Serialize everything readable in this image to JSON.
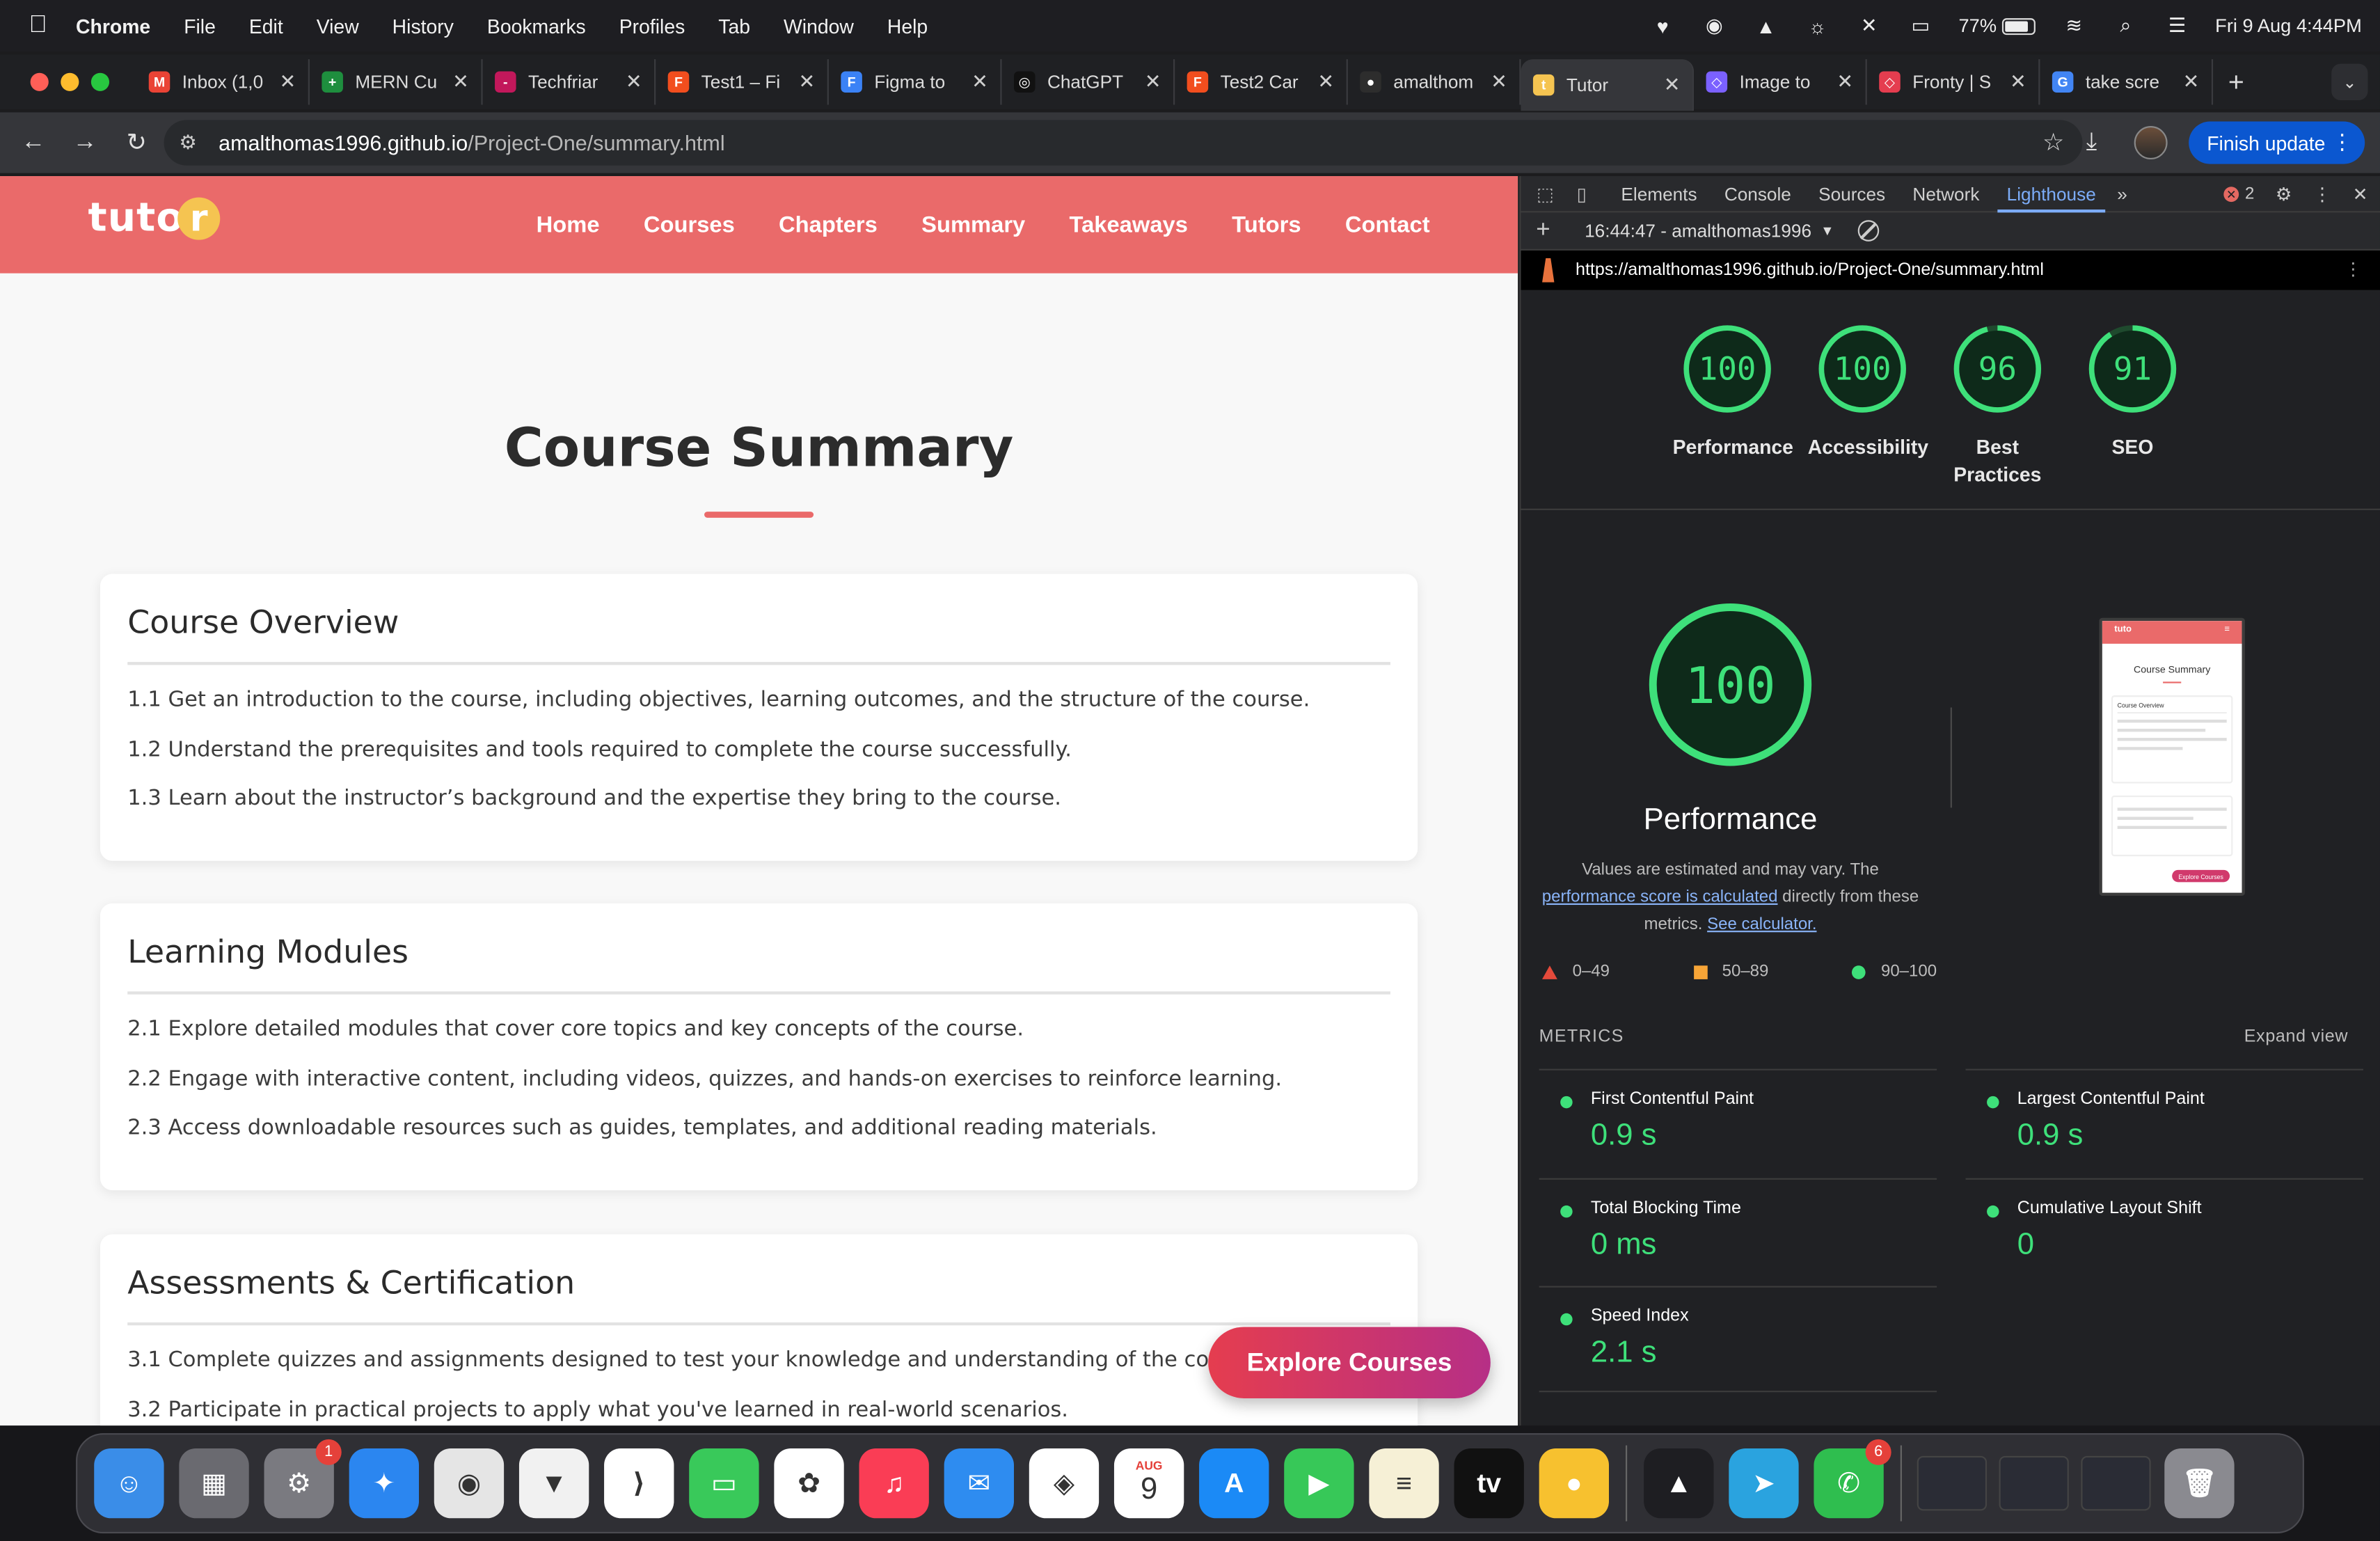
{
  "menubar": {
    "app_name": "Chrome",
    "items": [
      "File",
      "Edit",
      "View",
      "History",
      "Bookmarks",
      "Profiles",
      "Tab",
      "Window",
      "Help"
    ],
    "battery_percent": "77%",
    "datetime": "Fri 9 Aug  4:44PM"
  },
  "tabs": [
    {
      "label": "Inbox (1,0",
      "color": "#ea4335",
      "icon": "M"
    },
    {
      "label": "MERN Cu",
      "color": "#1e8e3e",
      "icon": "+"
    },
    {
      "label": "Techfriar",
      "color": "#c2185b",
      "icon": "-"
    },
    {
      "label": "Test1 – Fi",
      "color": "#f24e1e",
      "icon": "F"
    },
    {
      "label": "Figma to",
      "color": "#3b82f6",
      "icon": "F"
    },
    {
      "label": "ChatGPT",
      "color": "#111111",
      "icon": "◎"
    },
    {
      "label": "Test2 Car",
      "color": "#f24e1e",
      "icon": "F"
    },
    {
      "label": "amalthom",
      "color": "#2d2d2d",
      "icon": "●"
    },
    {
      "label": "Tutor",
      "color": "#f5c451",
      "icon": "t",
      "active": true
    },
    {
      "label": "Image to",
      "color": "#7b61ff",
      "icon": "◇"
    },
    {
      "label": "Fronty | S",
      "color": "#e53d4f",
      "icon": "◇"
    },
    {
      "label": "take scre",
      "color": "#4285f4",
      "icon": "G"
    }
  ],
  "toolbar": {
    "url_host": "amalthomas1996.github.io",
    "url_path": "/Project-One/summary.html",
    "finish_update": "Finish update"
  },
  "site": {
    "logo": "tuto",
    "logo_o": "r",
    "nav": [
      "Home",
      "Courses",
      "Chapters",
      "Summary",
      "Takeaways",
      "Tutors",
      "Contact"
    ],
    "page_title": "Course Summary",
    "cards": [
      {
        "title": "Course Overview",
        "items": [
          "1.1 Get an introduction to the course, including objectives, learning outcomes, and the structure of the course.",
          "1.2 Understand the prerequisites and tools required to complete the course successfully.",
          "1.3 Learn about the instructor’s background and the expertise they bring to the course."
        ]
      },
      {
        "title": "Learning Modules",
        "items": [
          "2.1 Explore detailed modules that cover core topics and key concepts of the course.",
          "2.2 Engage with interactive content, including videos, quizzes, and hands-on exercises to reinforce learning.",
          "2.3 Access downloadable resources such as guides, templates, and additional reading materials."
        ]
      },
      {
        "title": "Assessments & Certification",
        "items": [
          "3.1 Complete quizzes and assignments designed to test your knowledge and understanding of the course material.",
          "3.2 Participate in practical projects to apply what you've learned in real-world scenarios."
        ]
      }
    ],
    "explore_button": "Explore Courses"
  },
  "devtools": {
    "tabs": [
      "Elements",
      "Console",
      "Sources",
      "Network",
      "Lighthouse"
    ],
    "active_tab": "Lighthouse",
    "error_count": "2",
    "report_label": "16:44:47 - amalthomas1996",
    "report_url": "https://amalthomas1996.github.io/Project-One/summary.html",
    "scores": [
      {
        "label": "Performance",
        "score": 100
      },
      {
        "label": "Accessibility",
        "score": 100
      },
      {
        "label": "Best Practices",
        "score": 96
      },
      {
        "label": "SEO",
        "score": 91
      }
    ],
    "big": {
      "score": "100",
      "label": "Performance",
      "desc_pre": "Values are estimated and may vary. The ",
      "desc_link1": "performance score is calculated",
      "desc_mid": " directly from these metrics. ",
      "desc_link2": "See calculator."
    },
    "legend": [
      "0–49",
      "50–89",
      "90–100"
    ],
    "thumbnail": {
      "logo": "tuto",
      "title": "Course Summary",
      "card_title": "Course Overview",
      "button": "Explore Courses"
    },
    "metrics_title": "METRICS",
    "expand_view": "Expand view",
    "metrics": [
      {
        "name": "First Contentful Paint",
        "value": "0.9 s"
      },
      {
        "name": "Largest Contentful Paint",
        "value": "0.9 s"
      },
      {
        "name": "Total Blocking Time",
        "value": "0 ms"
      },
      {
        "name": "Cumulative Layout Shift",
        "value": "0"
      },
      {
        "name": "Speed Index",
        "value": "2.1 s"
      }
    ],
    "score_color": "#3ee07a"
  },
  "dock": {
    "apps": [
      {
        "name": "finder-icon",
        "color": "#3a8de8",
        "glyph": "☺"
      },
      {
        "name": "launchpad-icon",
        "color": "#6a6a70",
        "glyph": "▦"
      },
      {
        "name": "system-settings-icon",
        "color": "#7a7a80",
        "glyph": "⚙",
        "badge": "1"
      },
      {
        "name": "safari-icon",
        "color": "#2b86f0",
        "glyph": "✦"
      },
      {
        "name": "chrome-icon",
        "color": "#e5e5e5",
        "glyph": "◉"
      },
      {
        "name": "brave-icon",
        "color": "#f1f1f1",
        "glyph": "▼"
      },
      {
        "name": "vscode-icon",
        "color": "#ffffff",
        "glyph": "⟩"
      },
      {
        "name": "messages-icon",
        "color": "#39c95a",
        "glyph": "▭"
      },
      {
        "name": "photos-icon",
        "color": "#ffffff",
        "glyph": "✿"
      },
      {
        "name": "music-icon",
        "color": "#fa3d55",
        "glyph": "♫"
      },
      {
        "name": "mail-icon",
        "color": "#2e8cf0",
        "glyph": "✉"
      },
      {
        "name": "maps-icon",
        "color": "#ffffff",
        "glyph": "◈"
      },
      {
        "name": "calendar-icon",
        "color": "#ffffff",
        "glyph": "9",
        "month": "AUG"
      },
      {
        "name": "app-store-icon",
        "color": "#1b8af6",
        "glyph": "A"
      },
      {
        "name": "facetime-icon",
        "color": "#37c858",
        "glyph": "▶"
      },
      {
        "name": "notes-icon",
        "color": "#f6f0d6",
        "glyph": "≡"
      },
      {
        "name": "apple-tv-icon",
        "color": "#111111",
        "glyph": "tv"
      },
      {
        "name": "tips-icon",
        "color": "#f7c12f",
        "glyph": "●"
      },
      {
        "name": "vlc-icon",
        "color": "#1e1e22",
        "glyph": "▲",
        "sep_before": true
      },
      {
        "name": "telegram-icon",
        "color": "#2aa3df",
        "glyph": "➤"
      },
      {
        "name": "whatsapp-icon",
        "color": "#2fbe4f",
        "glyph": "✆",
        "badge": "6"
      }
    ]
  }
}
